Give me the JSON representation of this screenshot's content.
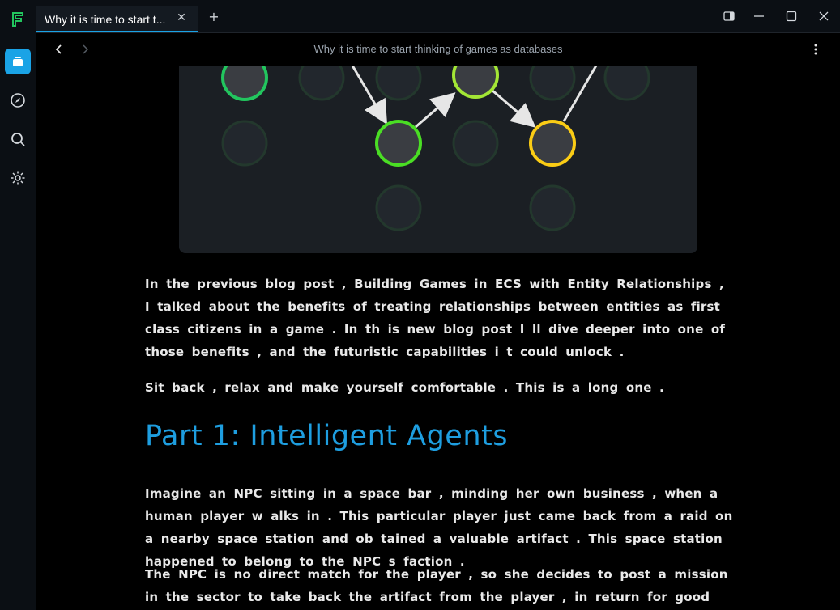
{
  "sidebar": {
    "icons": [
      "logo-icon",
      "library-icon",
      "compass-icon",
      "search-icon",
      "settings-icon"
    ],
    "accent": "#1aa3e6"
  },
  "tab": {
    "title": "Why it is time to start t...",
    "close": "✕",
    "new_tab": "+"
  },
  "nav": {
    "page_title": "Why it is time to start thinking of games as databases"
  },
  "article": {
    "p1": "In the previous blog post , Building Games in ECS with Entity Relationships , I talked about the benefits of treating relationships between entities as first class citizens in a game . In th is new blog post I ll dive deeper into one of those benefits , and the futuristic capabilities i t could unlock .",
    "p2": "Sit back , relax and make yourself comfortable . This is a long one .",
    "heading": "Part 1: Intelligent Agents",
    "p3": "Imagine an NPC sitting in a space bar , minding her own business , when a human player w alks in . This particular player just came back from a raid on a nearby space station and ob tained a valuable artifact . This space station happened to belong to the NPC s faction .",
    "p4": "The NPC is no direct match for the player , so she decides to post a mission in the sector to take back the artifact from the player , in return for good standing with the faction . Wit"
  },
  "colors": {
    "heading": "#1e9ee0",
    "node_green": "#22c55e",
    "node_lime": "#a3e635",
    "node_yellow": "#facc15"
  }
}
